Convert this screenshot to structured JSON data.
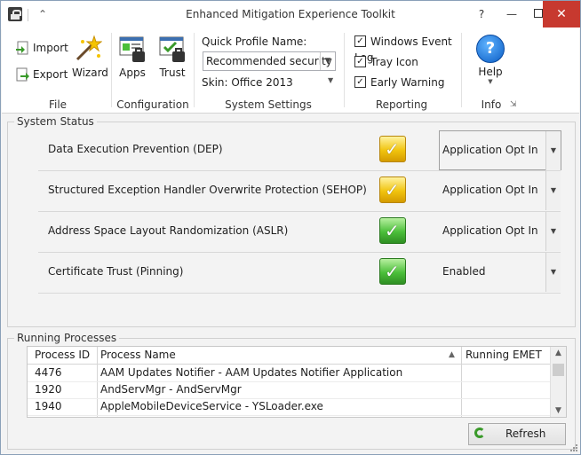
{
  "window": {
    "title": "Enhanced Mitigation Experience Toolkit",
    "help_glyph": "?",
    "min_glyph": "—",
    "close_glyph": "✕",
    "up_glyph": "⌃"
  },
  "ribbon": {
    "file": {
      "label": "File",
      "import_label": "Import",
      "export_label": "Export",
      "wizard_label": "Wizard"
    },
    "configuration": {
      "label": "Configuration",
      "apps_label": "Apps",
      "trust_label": "Trust"
    },
    "system_settings": {
      "label": "System Settings",
      "quick_profile_label": "Quick Profile Name:",
      "quick_profile_value": "Recommended security ...",
      "skin_label": "Skin: Office 2013"
    },
    "reporting": {
      "label": "Reporting",
      "windows_event_log": {
        "label": "Windows Event Log",
        "checked": true
      },
      "tray_icon": {
        "label": "Tray Icon",
        "checked": true
      },
      "early_warning": {
        "label": "Early Warning",
        "checked": true
      }
    },
    "info": {
      "label": "Info",
      "help_label": "Help"
    }
  },
  "system_status": {
    "legend": "System Status",
    "rows": [
      {
        "name": "Data Execution Prevention (DEP)",
        "state": "yellow",
        "value": "Application Opt In"
      },
      {
        "name": "Structured Exception Handler Overwrite Protection (SEHOP)",
        "state": "yellow",
        "value": "Application Opt In"
      },
      {
        "name": "Address Space Layout Randomization (ASLR)",
        "state": "green",
        "value": "Application Opt In"
      },
      {
        "name": "Certificate Trust (Pinning)",
        "state": "green",
        "value": "Enabled"
      }
    ]
  },
  "running_processes": {
    "legend": "Running Processes",
    "columns": [
      "Process ID",
      "Process Name",
      "Running EMET"
    ],
    "rows": [
      {
        "pid": "4476",
        "name": "AAM Updates Notifier - AAM Updates Notifier Application",
        "emet": ""
      },
      {
        "pid": "1920",
        "name": "AndServMgr - AndServMgr",
        "emet": ""
      },
      {
        "pid": "1940",
        "name": "AppleMobileDeviceService - YSLoader.exe",
        "emet": ""
      }
    ],
    "refresh_label": "Refresh"
  },
  "colors": {
    "close_button": "#c7392f",
    "shield_yellow": "#f1c40f",
    "shield_green": "#4bbf3a",
    "help_blue": "#0a5cc4"
  },
  "icons": {
    "import": "import-icon",
    "export": "export-icon",
    "wizard": "wizard-icon",
    "apps": "apps-icon",
    "trust": "trust-icon",
    "help": "help-icon",
    "refresh": "refresh-icon"
  }
}
